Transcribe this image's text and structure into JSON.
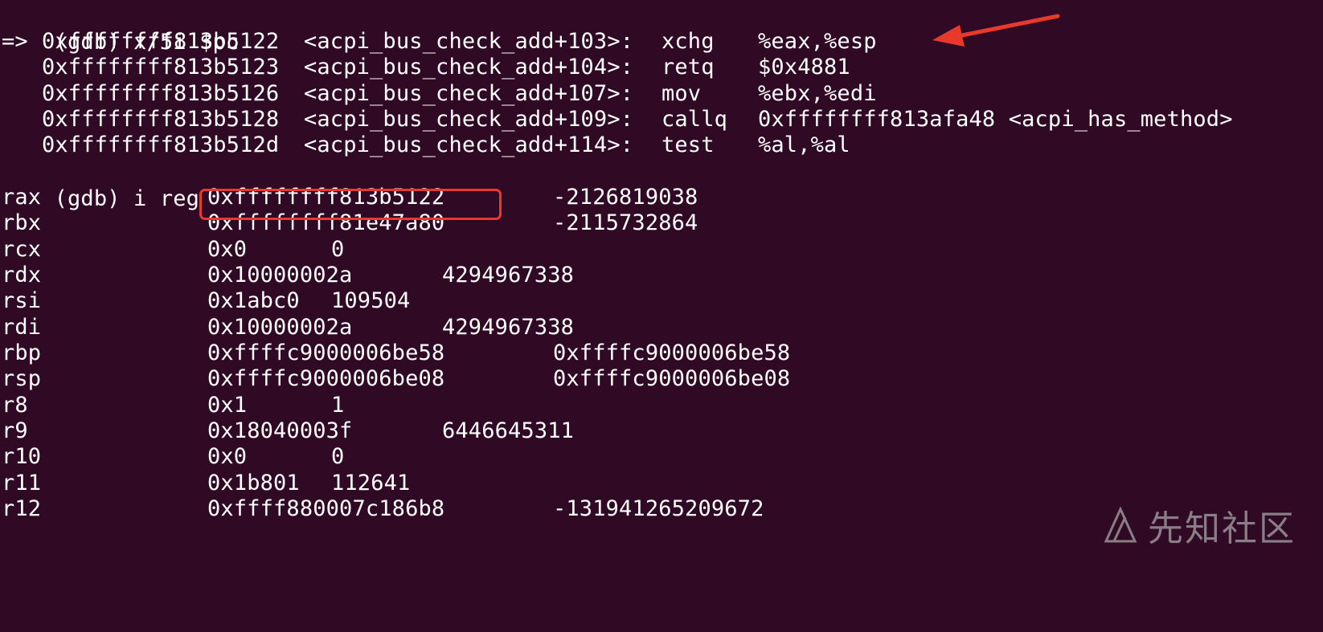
{
  "terminal": {
    "prompt_1": "(gdb) x/5i $pc",
    "instructions": [
      {
        "marker": "=>",
        "address": "0xffffffff813b5122",
        "symbol": "<acpi_bus_check_add+103>:",
        "mnemonic": "xchg",
        "operands": "%eax,%esp"
      },
      {
        "marker": "",
        "address": "0xffffffff813b5123",
        "symbol": "<acpi_bus_check_add+104>:",
        "mnemonic": "retq",
        "operands": "$0x4881"
      },
      {
        "marker": "",
        "address": "0xffffffff813b5126",
        "symbol": "<acpi_bus_check_add+107>:",
        "mnemonic": "mov",
        "operands": "%ebx,%edi"
      },
      {
        "marker": "",
        "address": "0xffffffff813b5128",
        "symbol": "<acpi_bus_check_add+109>:",
        "mnemonic": "callq",
        "operands": "0xffffffff813afa48 <acpi_has_method>"
      },
      {
        "marker": "",
        "address": "0xffffffff813b512d",
        "symbol": "<acpi_bus_check_add+114>:",
        "mnemonic": "test",
        "operands": "%al,%al"
      }
    ],
    "prompt_2": "(gdb) i reg",
    "registers": [
      {
        "name": "rax",
        "hex": "0xffffffff813b5122",
        "natural": "-2126819038"
      },
      {
        "name": "rbx",
        "hex": "0xffffffff81e47a80",
        "natural": "-2115732864"
      },
      {
        "name": "rcx",
        "hex": "0x0",
        "natural": "0"
      },
      {
        "name": "rdx",
        "hex": "0x10000002a",
        "natural": "4294967338"
      },
      {
        "name": "rsi",
        "hex": "0x1abc0",
        "natural": "109504"
      },
      {
        "name": "rdi",
        "hex": "0x10000002a",
        "natural": "4294967338"
      },
      {
        "name": "rbp",
        "hex": "0xffffc9000006be58",
        "natural": "0xffffc9000006be58"
      },
      {
        "name": "rsp",
        "hex": "0xffffc9000006be08",
        "natural": "0xffffc9000006be08"
      },
      {
        "name": "r8",
        "hex": "0x1",
        "natural": "1"
      },
      {
        "name": "r9",
        "hex": "0x18040003f",
        "natural": "6446645311"
      },
      {
        "name": "r10",
        "hex": "0x0",
        "natural": "0"
      },
      {
        "name": "r11",
        "hex": "0x1b801",
        "natural": "112641"
      },
      {
        "name": "r12",
        "hex": "0xffff880007c186b8",
        "natural": "-131941265209672"
      }
    ]
  },
  "watermark": {
    "text": "先知社区",
    "icon": "xianzhi-logo-icon"
  },
  "colors": {
    "background": "#300a24",
    "text": "#ffffff",
    "annotation": "#e8392c",
    "watermark": "#8a7e86"
  }
}
